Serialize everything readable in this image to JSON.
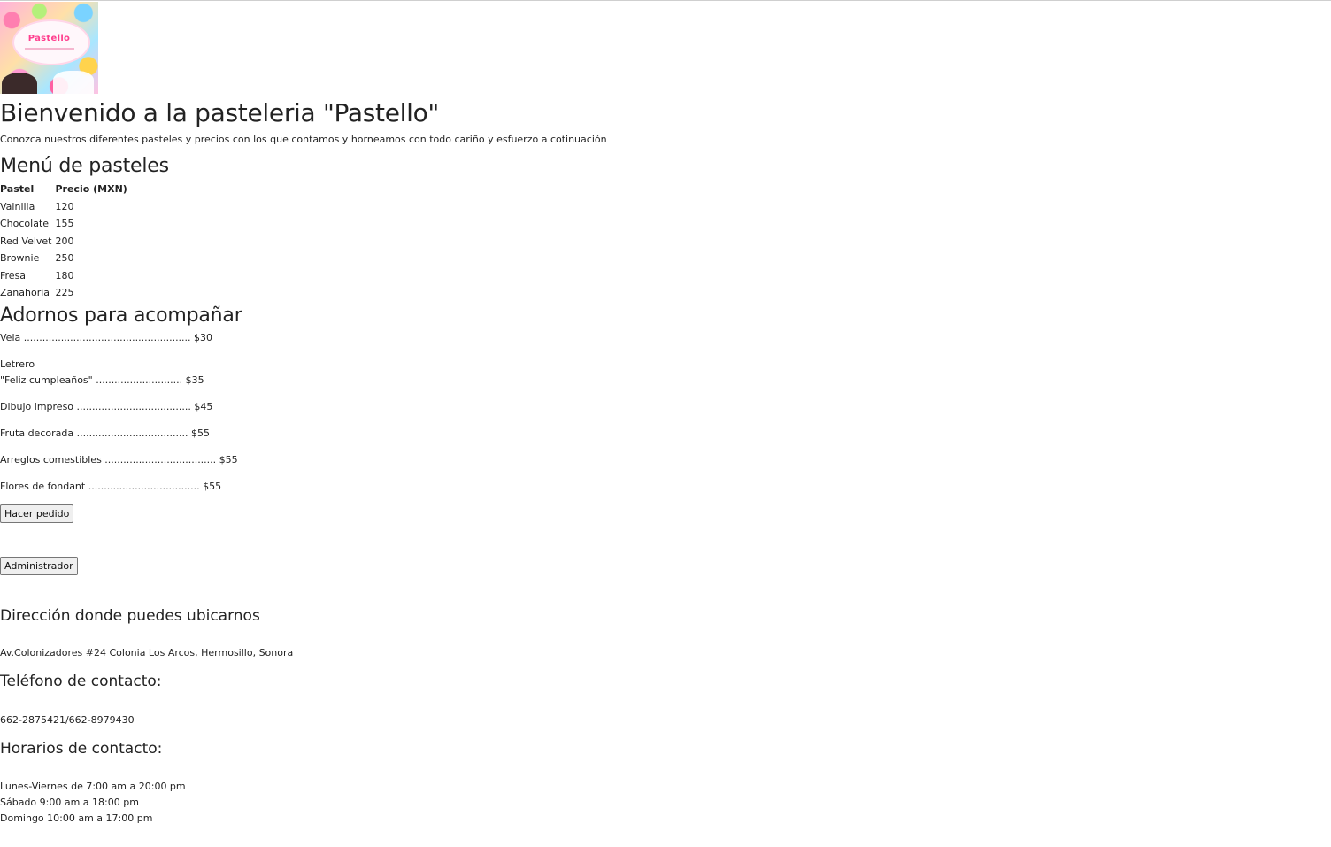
{
  "logo": {
    "text": "Pastello"
  },
  "header": {
    "title": "Bienvenido a la pasteleria \"Pastello\"",
    "subtitle": "Conozca nuestros diferentes pasteles y precios con los que contamos y horneamos con todo cariño y esfuerzo a cotinuación"
  },
  "menu": {
    "heading": "Menú de pasteles",
    "columns": [
      "Pastel",
      "Precio (MXN)"
    ],
    "rows": [
      {
        "name": "Vainilla",
        "price": "120"
      },
      {
        "name": "Chocolate",
        "price": "155"
      },
      {
        "name": "Red Velvet",
        "price": "200"
      },
      {
        "name": "Brownie",
        "price": "250"
      },
      {
        "name": "Fresa",
        "price": "180"
      },
      {
        "name": "Zanahoria",
        "price": "225"
      }
    ]
  },
  "adornos": {
    "heading": "Adornos para acompañar",
    "items": [
      {
        "line1": "Vela ...................................................... $30"
      },
      {
        "line1": "Letrero",
        "line2": "\"Feliz cumpleaños\" ............................ $35"
      },
      {
        "line1": "Dibujo impreso ..................................... $45"
      },
      {
        "line1": "Fruta decorada .................................... $55"
      },
      {
        "line1": "Arreglos comestibles .................................... $55"
      },
      {
        "line1": "Flores de fondant .................................... $55"
      }
    ]
  },
  "buttons": {
    "order": "Hacer pedido",
    "admin": "Administrador"
  },
  "contact": {
    "address_heading": "Dirección donde puedes ubicarnos",
    "address": "Av.Colonizadores #24 Colonia Los Arcos, Hermosillo, Sonora",
    "phone_heading": "Teléfono de contacto:",
    "phone": "662-2875421/662-8979430",
    "hours_heading": "Horarios de contacto:",
    "hours": [
      "Lunes-Viernes de 7:00 am a 20:00 pm",
      "Sábado 9:00 am a 18:00 pm",
      "Domingo 10:00 am a 17:00 pm"
    ]
  }
}
